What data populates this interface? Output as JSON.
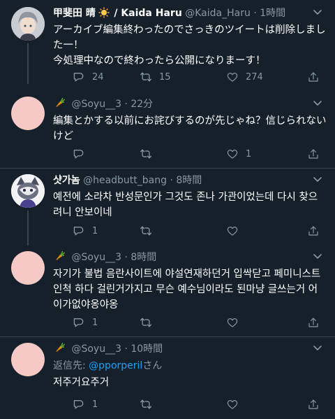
{
  "tweets": [
    {
      "name": "甲斐田 晴",
      "name_suffix": "/ Kaida Haru",
      "handle": "@Kaida_Haru",
      "time": "1時間",
      "body": "アーカイブ編集終わったのでさっきのツイートは削除しました一！\n今処理中なので終わったら公開になりまーす！",
      "replies": "24",
      "retweets": "15",
      "likes": "274"
    },
    {
      "name": "",
      "handle": "@Soyu__3",
      "time": "22分",
      "body": "編集とかする以前にお詫びするのが先じゃね？信じられないけど",
      "replies": "",
      "retweets": "",
      "likes": "1"
    },
    {
      "name": "샷가놈",
      "handle": "@headbutt_bang",
      "time": "8時間",
      "body": "예전에 소라차 반성문인가 그것도 존나 가관이었는데 다시 찾으려니 안보이네",
      "replies": "1",
      "retweets": "",
      "likes": ""
    },
    {
      "name": "",
      "handle": "@Soyu__3",
      "time": "8時間",
      "body": "자기가 불법 음란사이트에 야설연재하던거 입싹닫고 페미니스트 인척 하다 걸린거가지고 무슨 예수님이라도 된마냥 글쓰는거 어이가없야옹야옹",
      "replies": "1",
      "retweets": "",
      "likes": ""
    },
    {
      "name": "",
      "handle": "@Soyu__3",
      "time": "10時間",
      "reply_prefix": "返信先: ",
      "reply_mention": "@pporperil",
      "reply_suffix": "さん",
      "body": "저주거요주거",
      "replies": "1",
      "retweets": "",
      "likes": ""
    }
  ],
  "dot": "·",
  "colors": {
    "background": "#15202b",
    "text": "#ffffff",
    "secondary": "#8899a6",
    "accent": "#1da1f2",
    "divider": "#38444d",
    "avatar_pink": "#f5c9c6"
  },
  "icons": [
    "carrot-emoji",
    "sun-emoji",
    "reply-icon",
    "retweet-icon",
    "like-icon",
    "share-icon",
    "chevron-down-icon"
  ]
}
